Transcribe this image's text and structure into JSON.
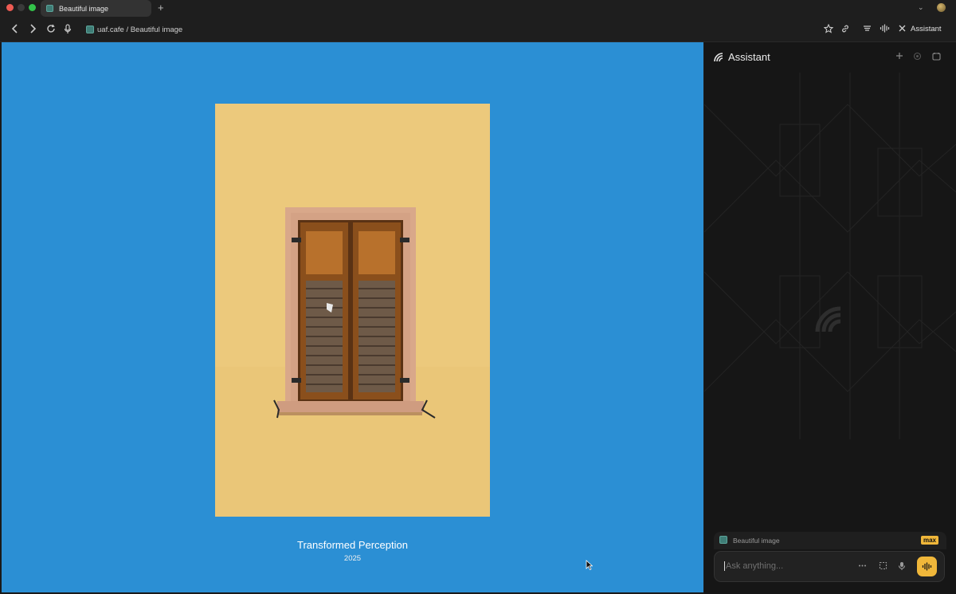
{
  "browser": {
    "tab_title": "Beautiful image",
    "new_tab_icon": "plus-icon",
    "url_text": "uaf.cafe / Beautiful image",
    "assistant_toggle_label": "Assistant"
  },
  "artwork": {
    "title": "Transformed Perception",
    "year": "2025",
    "background_color": "#2b8fd4",
    "wall_color": "#ecc97c"
  },
  "assistant": {
    "title": "Assistant",
    "context_label": "Beautiful image",
    "badge": "max",
    "input_placeholder": "Ask anything...",
    "accent_color": "#f0b73a"
  }
}
